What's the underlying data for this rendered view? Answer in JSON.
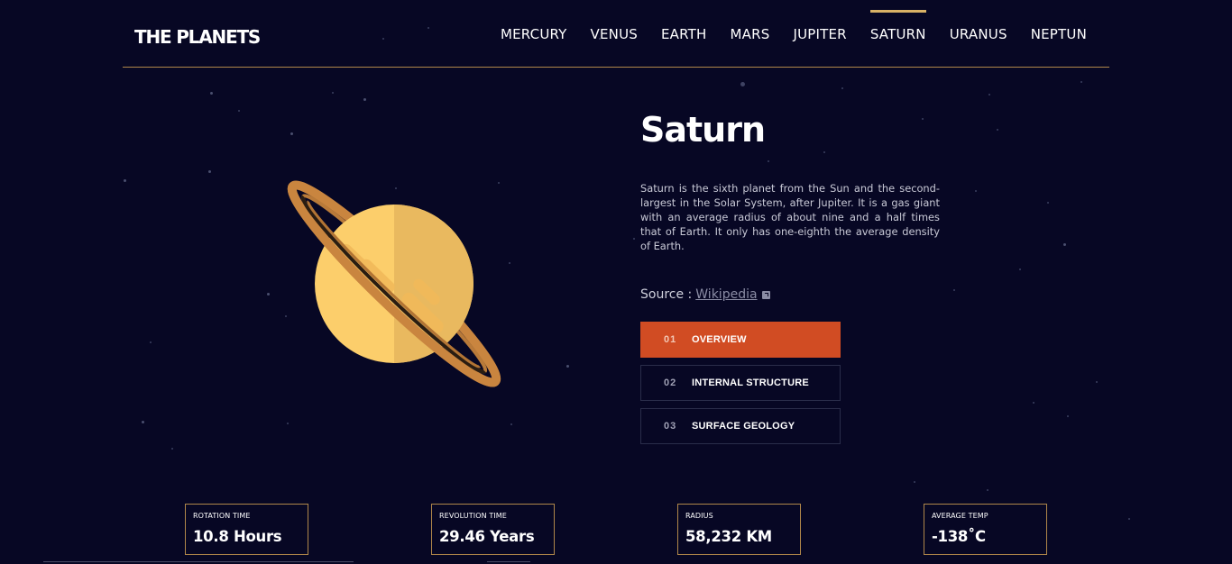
{
  "header": {
    "logo": "THE PLANETS",
    "nav": [
      "MERCURY",
      "VENUS",
      "EARTH",
      "MARS",
      "JUPITER",
      "SATURN",
      "URANUS",
      "NEPTUN"
    ],
    "active": "SATURN",
    "accent_color": "#d9b266"
  },
  "planet": {
    "name": "Saturn",
    "image_icon": "saturn-illustration",
    "description": "Saturn is the sixth planet from the Sun and the second-largest in the Solar System, after Jupiter. It is a gas giant with an average radius of about nine and a half times that of Earth. It only has one-eighth the average density of Earth.",
    "source_label": "Source :",
    "source_link": "Wikipedia",
    "source_icon": "external-link-icon"
  },
  "tabs": [
    {
      "num": "01",
      "label": "OVERVIEW",
      "active": true
    },
    {
      "num": "02",
      "label": "INTERNAL STRUCTURE",
      "active": false
    },
    {
      "num": "03",
      "label": "SURFACE GEOLOGY",
      "active": false
    }
  ],
  "tab_active_color": "#d14c23",
  "stats": [
    {
      "label": "ROTATION TIME",
      "value": "10.8 Hours"
    },
    {
      "label": "REVOLUTION TIME",
      "value": "29.46 Years"
    },
    {
      "label": "RADIUS",
      "value": "58,232 KM"
    },
    {
      "label": "AVERAGE TEMP",
      "value": "-138˚C"
    }
  ],
  "background_color": "#070724"
}
